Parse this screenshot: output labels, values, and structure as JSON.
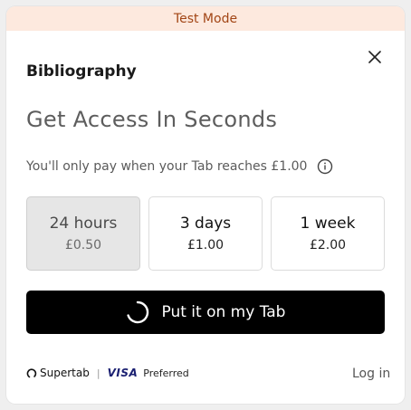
{
  "banner": {
    "text": "Test Mode"
  },
  "header": {
    "site_name": "Bibliography",
    "close_icon": "close-icon"
  },
  "headline": "Get Access In Seconds",
  "pay_note": {
    "text": "You'll only pay when your Tab reaches £1.00",
    "icon": "info-icon"
  },
  "options": [
    {
      "label": "24 hours",
      "price": "£0.50",
      "selected": true
    },
    {
      "label": "3 days",
      "price": "£1.00",
      "selected": false
    },
    {
      "label": "1 week",
      "price": "£2.00",
      "selected": false
    }
  ],
  "cta": {
    "label": "Put it on my Tab",
    "icon": "loading-spinner-icon"
  },
  "footer": {
    "brand": "Supertab",
    "separator": "|",
    "visa": "VISA",
    "preferred": "Preferred",
    "login": "Log in"
  },
  "colors": {
    "banner_bg": "#fde9de",
    "banner_text": "#a24515",
    "cta_bg": "#000000",
    "selected_bg": "#e6e6e6"
  }
}
